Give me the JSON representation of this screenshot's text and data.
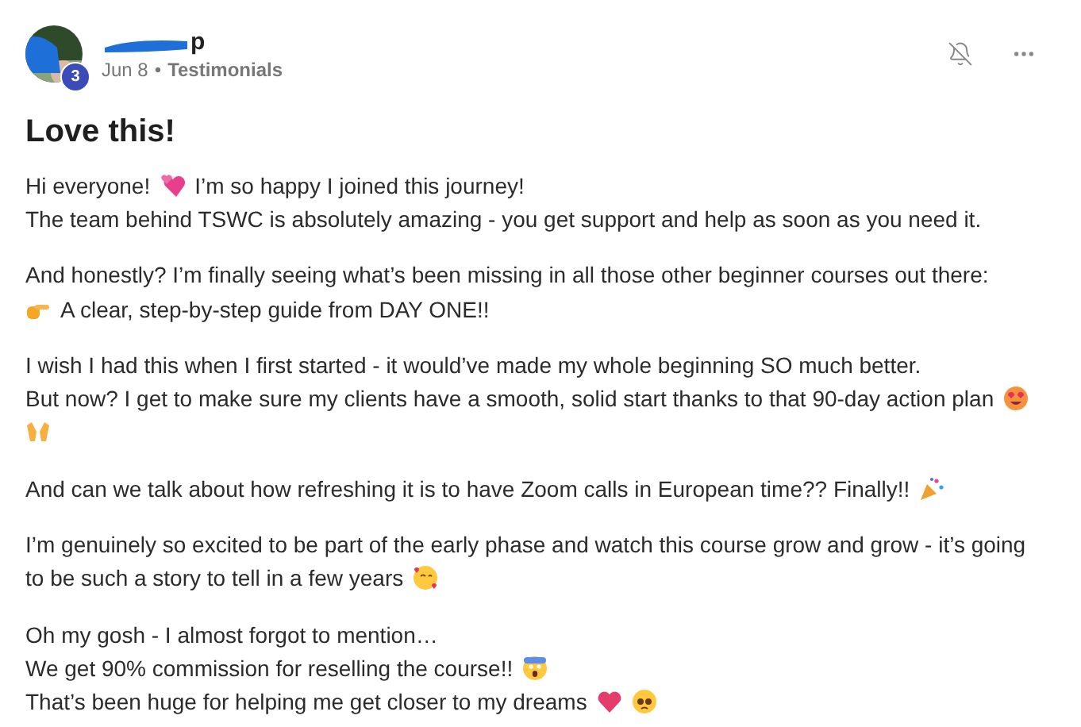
{
  "post": {
    "author_visible": "p",
    "level_badge": "3",
    "date": "Jun 8",
    "separator": "•",
    "category": "Testimonials",
    "title": "Love this!",
    "paragraphs": [
      {
        "lines": [
          [
            {
              "kind": "text",
              "text": "Hi everyone!"
            },
            {
              "kind": "hearts"
            },
            {
              "kind": "text",
              "text": "I’m so happy I joined this journey!"
            }
          ],
          [
            {
              "kind": "text",
              "text": "The team behind TSWC is absolutely amazing - you get support and help as soon as you need it."
            }
          ]
        ]
      },
      {
        "lines": [
          [
            {
              "kind": "text",
              "text": "And honestly? I’m finally seeing what’s been missing in all those other beginner courses out there:"
            }
          ],
          [
            {
              "kind": "pointing"
            },
            {
              "kind": "text",
              "text": "A clear, step-by-step guide from DAY ONE!!"
            }
          ]
        ]
      },
      {
        "lines": [
          [
            {
              "kind": "text",
              "text": "I wish I had this when I first started - it would’ve made my whole beginning SO much better."
            }
          ],
          [
            {
              "kind": "text",
              "text": "But now? I get to make sure my clients have a smooth, solid start thanks to that 90-day action plan"
            },
            {
              "kind": "hearteyes"
            }
          ],
          [
            {
              "kind": "raisedhands"
            }
          ]
        ]
      },
      {
        "lines": [
          [
            {
              "kind": "text",
              "text": "And can we talk about how refreshing it is to have Zoom calls in European time?? Finally!!"
            },
            {
              "kind": "party"
            }
          ]
        ]
      },
      {
        "lines": [
          [
            {
              "kind": "text",
              "text": "I’m genuinely so excited to be part of the early phase and watch this course grow and grow - it’s going"
            }
          ],
          [
            {
              "kind": "text",
              "text": "to be such a story to tell in a few years"
            },
            {
              "kind": "heartsface"
            }
          ]
        ]
      },
      {
        "lines": [
          [
            {
              "kind": "text",
              "text": "Oh my gosh - I almost forgot to mention…"
            }
          ],
          [
            {
              "kind": "text",
              "text": "We get 90% commission for reselling the course!!"
            },
            {
              "kind": "scream"
            }
          ],
          [
            {
              "kind": "text",
              "text": "That’s been huge for helping me get closer to my dreams"
            },
            {
              "kind": "heart"
            },
            {
              "kind": "pleading"
            }
          ]
        ]
      }
    ]
  }
}
